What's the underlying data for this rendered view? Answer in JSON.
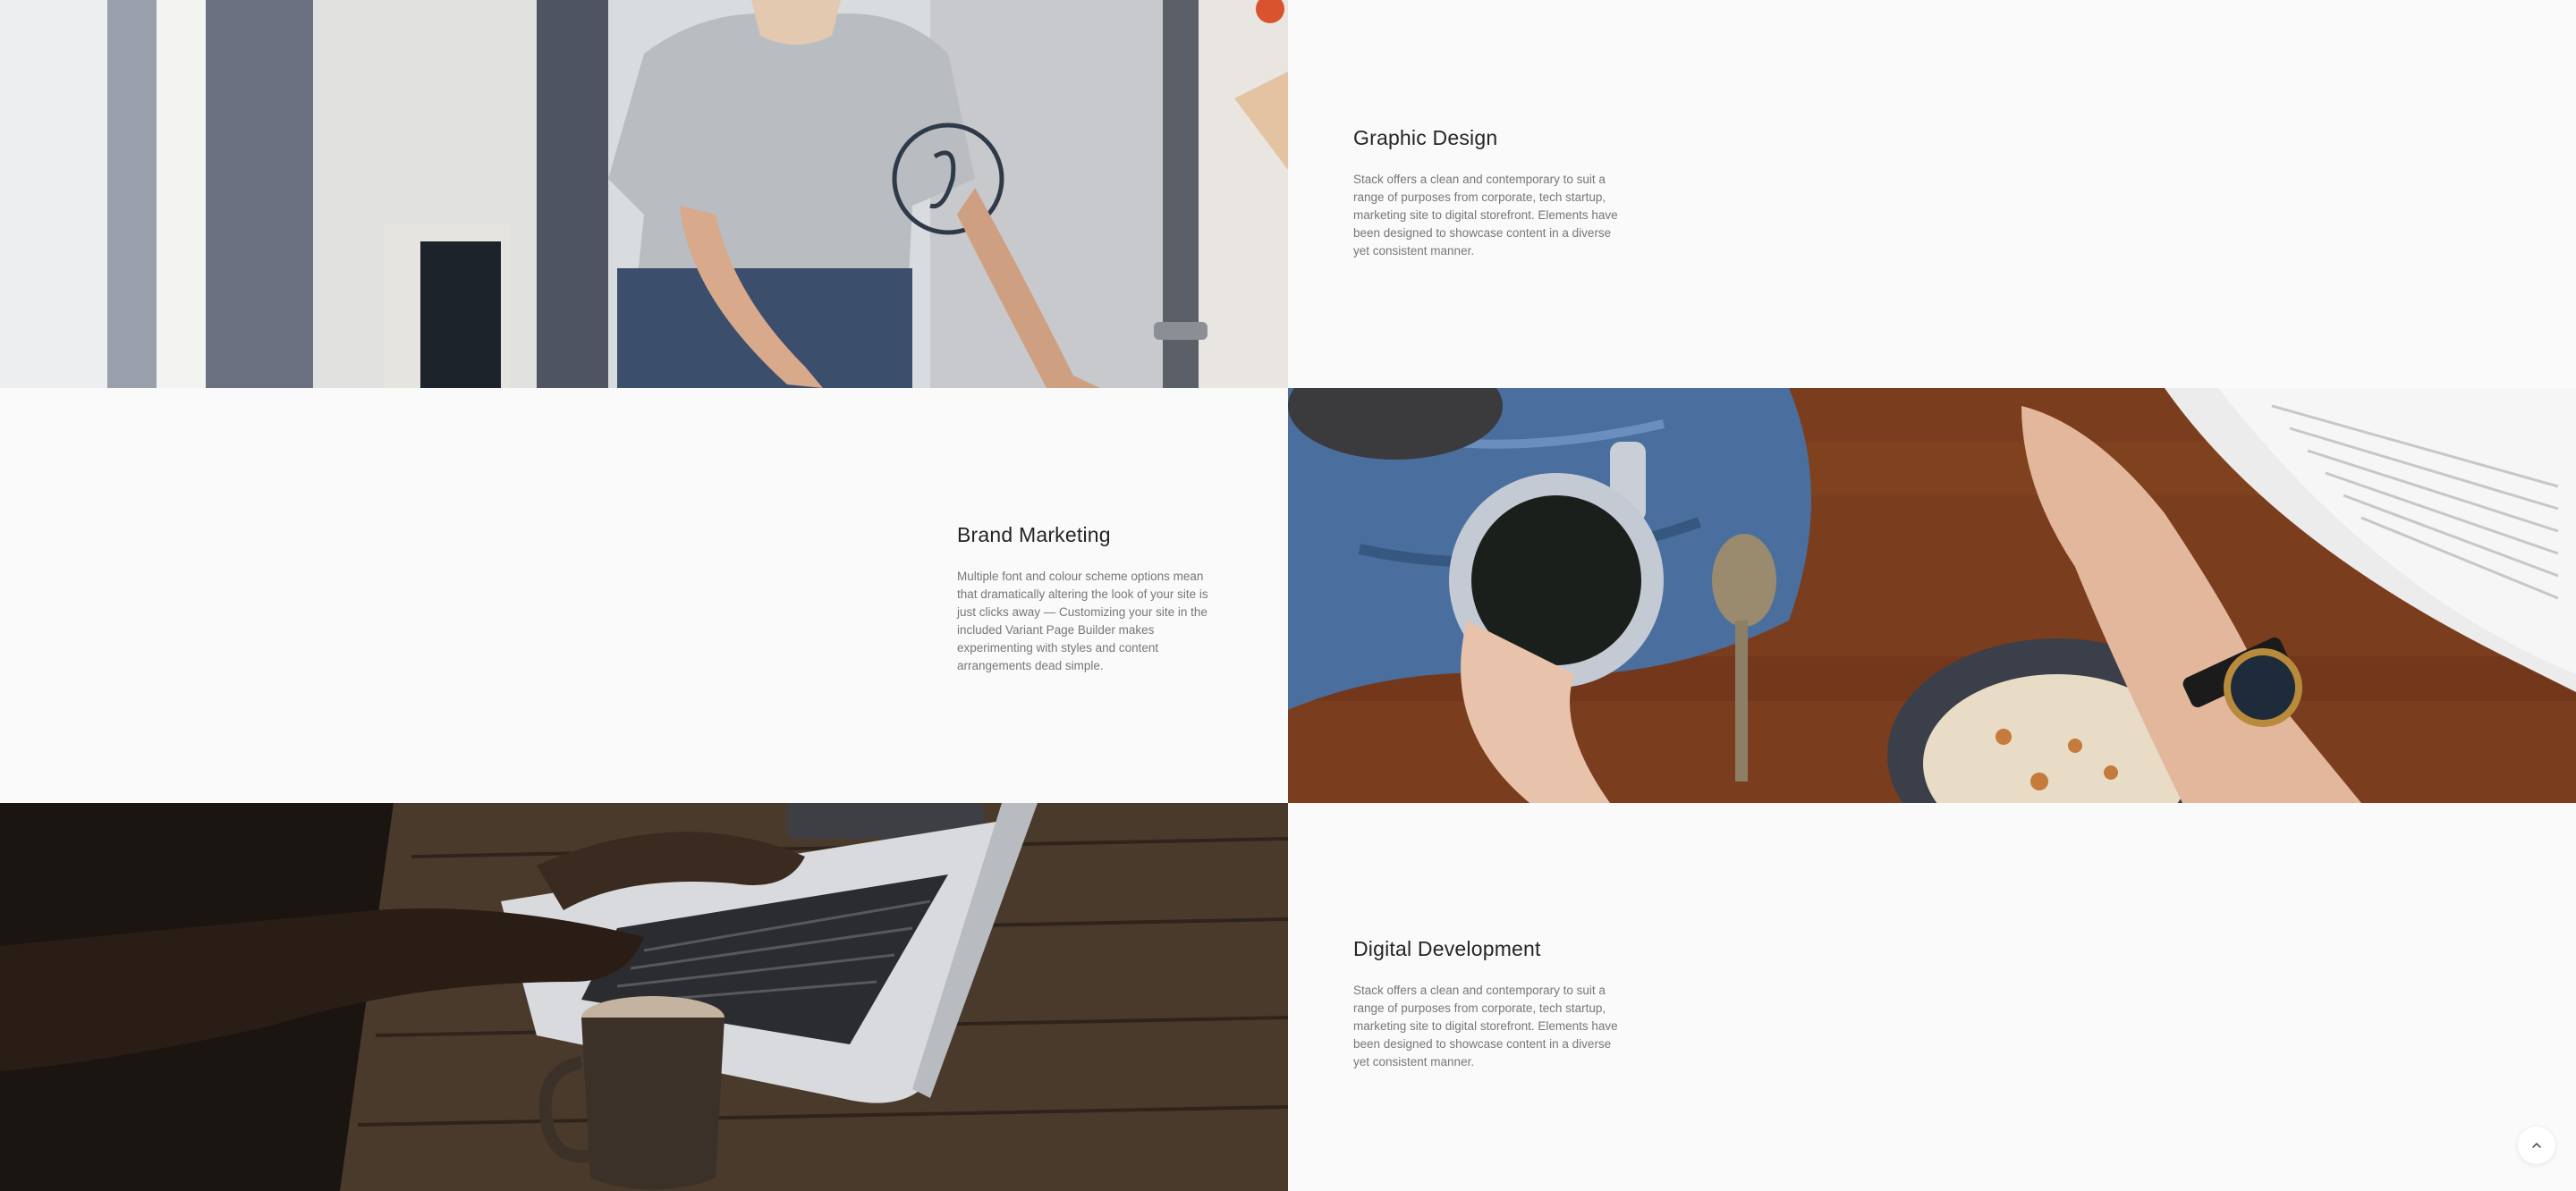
{
  "features": [
    {
      "title": "Graphic Design",
      "body": "Stack offers a clean and contemporary to suit a range of purposes from corporate, tech startup, marketing site to digital storefront. Elements have been designed to showcase content in a diverse yet consistent manner."
    },
    {
      "title": "Brand Marketing",
      "body": "Multiple font and colour scheme options mean that dramatically altering the look of your site is just clicks away — Customizing your site in the included Variant Page Builder makes experimenting with styles and content arrangements dead simple."
    },
    {
      "title": "Digital Development",
      "body": "Stack offers a clean and contemporary to suit a range of purposes from corporate, tech startup, marketing site to digital storefront. Elements have been designed to showcase content in a diverse yet consistent manner."
    }
  ],
  "back_to_top": {
    "icon": "chevron-up-icon"
  },
  "colors": {
    "background": "#fafafa",
    "heading": "#252525",
    "body_text": "#777777"
  }
}
